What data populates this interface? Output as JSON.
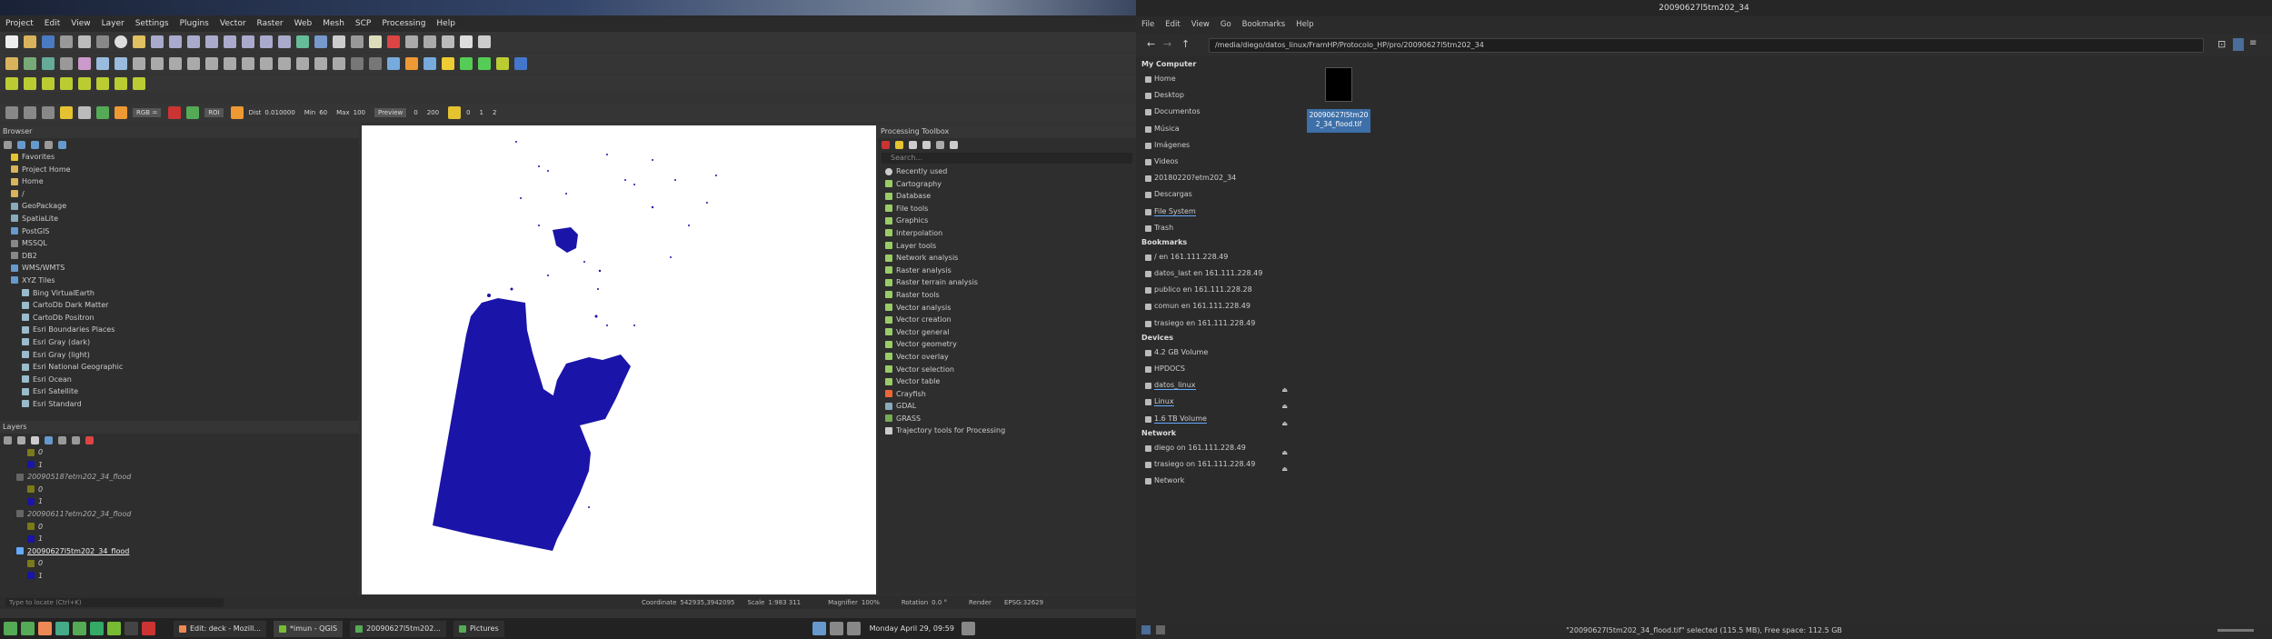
{
  "qgis": {
    "menu": [
      "Project",
      "Edit",
      "View",
      "Layer",
      "Settings",
      "Plugins",
      "Vector",
      "Raster",
      "Web",
      "Mesh",
      "SCP",
      "Processing",
      "Help"
    ],
    "toolbar": {
      "band_set_label": "RGB =",
      "roi_label": "ROI",
      "dist_label": "Dist",
      "dist_value": "0.010000",
      "min_label": "Min",
      "min_value": "60",
      "max_label": "Max",
      "max_value": "100",
      "preview_label": "Preview",
      "val0": "0",
      "val200": "200",
      "v1": "0",
      "v2": "1",
      "v3": "2"
    },
    "browser": {
      "title": "Browser",
      "items": [
        "Favorites",
        "Project Home",
        "Home",
        "/",
        "GeoPackage",
        "SpatiaLite",
        "PostGIS",
        "MSSQL",
        "DB2",
        "WMS/WMTS",
        "XYZ Tiles",
        "Bing VirtualEarth",
        "CartoDb Dark Matter",
        "CartoDb Positron",
        "Esri Boundaries Places",
        "Esri Gray (dark)",
        "Esri Gray (light)",
        "Esri National Geographic",
        "Esri Ocean",
        "Esri Satellite",
        "Esri Standard"
      ]
    },
    "layers": {
      "title": "Layers",
      "rows": [
        "0",
        "1",
        "20090518?etm202_34_flood",
        "0",
        "1",
        "20090611?etm202_34_flood",
        "0",
        "1",
        "20090627l5tm202_34_flood",
        "0",
        "1"
      ]
    },
    "processing": {
      "title": "Processing Toolbox",
      "search_placeholder": "Search...",
      "items": [
        "Recently used",
        "Cartography",
        "Database",
        "File tools",
        "Graphics",
        "Interpolation",
        "Layer tools",
        "Network analysis",
        "Raster analysis",
        "Raster terrain analysis",
        "Raster tools",
        "Vector analysis",
        "Vector creation",
        "Vector general",
        "Vector geometry",
        "Vector overlay",
        "Vector selection",
        "Vector table",
        "Crayfish",
        "GDAL",
        "GRASS",
        "Trajectory tools for Processing"
      ]
    },
    "locator_placeholder": "Type to locate (Ctrl+K)",
    "status": {
      "coord_label": "Coordinate",
      "coord": "542935,3942095",
      "scale_label": "Scale",
      "scale": "1:983 311",
      "magnifier_label": "Magnifier",
      "magnifier": "100%",
      "rotation_label": "Rotation",
      "rotation": "0.0 °",
      "render_label": "Render",
      "crs": "EPSG:32629"
    },
    "raster_color": "#1a14a8"
  },
  "taskbar": {
    "tasks": [
      "Edit: deck - Mozill...",
      "*imun - QGIS",
      "20090627l5tm202...",
      "Pictures"
    ],
    "clock": "Monday April 29, 09:59"
  },
  "files": {
    "title": "20090627l5tm202_34",
    "menu": [
      "File",
      "Edit",
      "View",
      "Go",
      "Bookmarks",
      "Help"
    ],
    "location": "/media/diego/datos_linux/FramHP/Protocolo_HP/pro/20090627l5tm202_34",
    "sections": [
      {
        "header": "My Computer",
        "items": [
          {
            "label": "Home"
          },
          {
            "label": "Desktop"
          },
          {
            "label": "Documentos"
          },
          {
            "label": "Música"
          },
          {
            "label": "Imágenes"
          },
          {
            "label": "Videos"
          },
          {
            "label": "20180220?etm202_34"
          },
          {
            "label": "Descargas"
          },
          {
            "label": "File System"
          },
          {
            "label": "Trash"
          }
        ]
      },
      {
        "header": "Bookmarks",
        "items": [
          {
            "label": "/ en 161.111.228.49"
          },
          {
            "label": "datos_last en 161.111.228.49"
          },
          {
            "label": "publico en 161.111.228.28"
          },
          {
            "label": "comun en 161.111.228.49"
          },
          {
            "label": "trasiego en 161.111.228.49"
          }
        ]
      },
      {
        "header": "Devices",
        "items": [
          {
            "label": "4.2 GB Volume"
          },
          {
            "label": "HPDOCS"
          },
          {
            "label": "datos_linux"
          },
          {
            "label": "Linux"
          },
          {
            "label": "1.6 TB Volume"
          }
        ]
      },
      {
        "header": "Network",
        "items": [
          {
            "label": "diego on 161.111.228.49"
          },
          {
            "label": "trasiego on 161.111.228.49"
          },
          {
            "label": "Network"
          }
        ]
      }
    ],
    "file_name": "20090627l5tm202_34_flood.tif",
    "status": "\"20090627l5tm202_34_flood.tif\" selected (115.5 MB), Free space: 112.5 GB"
  }
}
